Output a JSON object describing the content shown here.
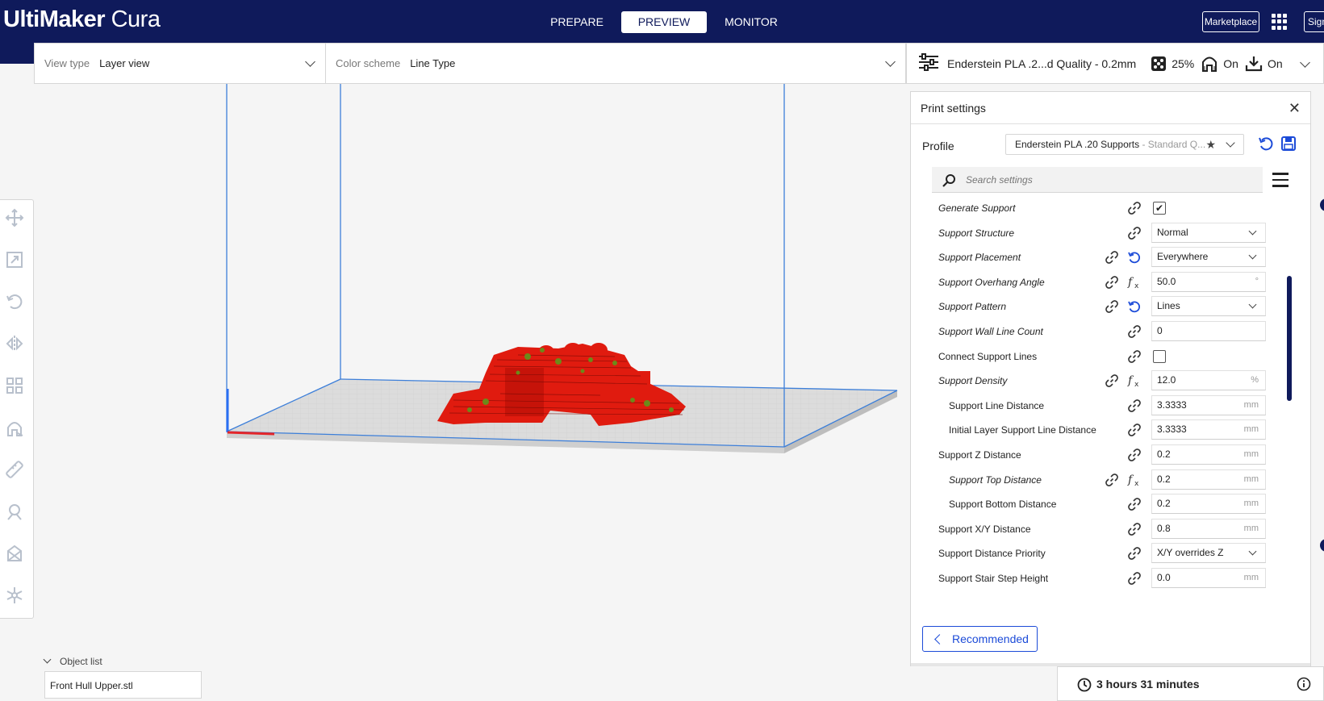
{
  "app": {
    "logo_bold": "UltiMaker",
    "logo_light": " Cura",
    "tabs": [
      "PREPARE",
      "PREVIEW",
      "MONITOR"
    ],
    "active_tab": "PREVIEW",
    "marketplace_label": "Marketplace",
    "sign_label": "Sign"
  },
  "view_bar": {
    "view_type_label": "View type",
    "view_type_value": "Layer view",
    "color_scheme_label": "Color scheme",
    "color_scheme_value": "Line Type"
  },
  "summary": {
    "profile_text": "Enderstein PLA .2...d Quality - 0.2mm",
    "infill": "25%",
    "support": "On",
    "adhesion": "On"
  },
  "panel": {
    "title": "Print settings",
    "profile_label": "Profile",
    "profile_name": "Enderstein PLA .20 Supports",
    "profile_sub": " - Standard Q...",
    "search_placeholder": "Search settings",
    "recommended_label": "Recommended",
    "settings": [
      {
        "name": "Generate Support",
        "italic": true,
        "indent": 0,
        "type": "check",
        "checked": true,
        "value": "",
        "unit": "",
        "reset": false,
        "fx": false
      },
      {
        "name": "Support Structure",
        "italic": true,
        "indent": 0,
        "type": "select",
        "value": "Normal",
        "unit": "",
        "reset": false,
        "fx": false
      },
      {
        "name": "Support Placement",
        "italic": true,
        "indent": 0,
        "type": "select",
        "value": "Everywhere",
        "unit": "",
        "reset": true,
        "fx": false
      },
      {
        "name": "Support Overhang Angle",
        "italic": true,
        "indent": 0,
        "type": "text",
        "value": "50.0",
        "unit": "°",
        "reset": false,
        "fx": true
      },
      {
        "name": "Support Pattern",
        "italic": true,
        "indent": 0,
        "type": "select",
        "value": "Lines",
        "unit": "",
        "reset": true,
        "fx": false
      },
      {
        "name": "Support Wall Line Count",
        "italic": true,
        "indent": 0,
        "type": "text",
        "value": "0",
        "unit": "",
        "reset": false,
        "fx": false
      },
      {
        "name": "Connect Support Lines",
        "italic": false,
        "indent": 0,
        "type": "check",
        "checked": false,
        "value": "",
        "unit": "",
        "reset": false,
        "fx": false
      },
      {
        "name": "Support Density",
        "italic": true,
        "indent": 0,
        "type": "text",
        "value": "12.0",
        "unit": "%",
        "reset": false,
        "fx": true
      },
      {
        "name": "Support Line Distance",
        "italic": false,
        "indent": 1,
        "type": "text",
        "value": "3.3333",
        "unit": "mm",
        "reset": false,
        "fx": false
      },
      {
        "name": "Initial Layer Support Line Distance",
        "italic": false,
        "indent": 1,
        "type": "text",
        "value": "3.3333",
        "unit": "mm",
        "reset": false,
        "fx": false
      },
      {
        "name": "Support Z Distance",
        "italic": false,
        "indent": 0,
        "type": "text",
        "value": "0.2",
        "unit": "mm",
        "reset": false,
        "fx": false
      },
      {
        "name": "Support Top Distance",
        "italic": true,
        "indent": 1,
        "type": "text",
        "value": "0.2",
        "unit": "mm",
        "reset": false,
        "fx": true
      },
      {
        "name": "Support Bottom Distance",
        "italic": false,
        "indent": 1,
        "type": "text",
        "value": "0.2",
        "unit": "mm",
        "reset": false,
        "fx": false
      },
      {
        "name": "Support X/Y Distance",
        "italic": false,
        "indent": 0,
        "type": "text",
        "value": "0.8",
        "unit": "mm",
        "reset": false,
        "fx": false
      },
      {
        "name": "Support Distance Priority",
        "italic": false,
        "indent": 0,
        "type": "select",
        "value": "X/Y overrides Z",
        "unit": "",
        "reset": false,
        "fx": false
      },
      {
        "name": "Support Stair Step Height",
        "italic": false,
        "indent": 0,
        "type": "text",
        "value": "0.0",
        "unit": "mm",
        "reset": false,
        "fx": false
      }
    ]
  },
  "object_list": {
    "label": "Object list",
    "item": "Front Hull Upper.stl"
  },
  "print_time": "3 hours 31 minutes",
  "colors": {
    "header": "#0f1a5b",
    "accent": "#1c4bd8",
    "model": "#e01b0f",
    "build_volume": "#3d7fd9"
  },
  "tools": [
    "move-icon",
    "scale-icon",
    "rotate-icon",
    "mirror-icon",
    "per-model-settings-icon",
    "support-blocker-icon",
    "measure-icon",
    "paint-icon",
    "tree-support-icon",
    "extra-tool-icon"
  ]
}
